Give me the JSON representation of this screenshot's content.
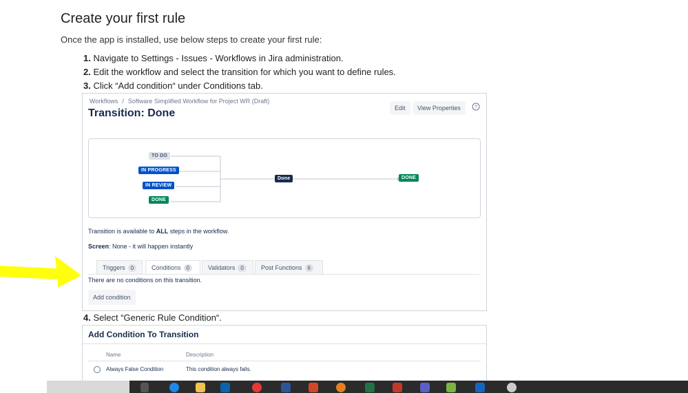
{
  "doc": {
    "title": "Create your first rule",
    "intro": "Once the app is installed, use below steps to create your first rule:",
    "steps": [
      {
        "num": "1.",
        "text": " Navigate to Settings - Issues - Workflows in Jira administration."
      },
      {
        "num": "2.",
        "text": " Edit the workflow and select the transition for which you want to define rules."
      },
      {
        "num": "3.",
        "text": " Click “Add condition“ under Conditions tab."
      },
      {
        "num": "4.",
        "text": " Select “Generic Rule Condition“."
      }
    ]
  },
  "jira": {
    "breadcrumb": {
      "root": "Workflows",
      "sep": "/",
      "current": "Software Simplified Workflow for Project WR (Draft)"
    },
    "title": "Transition: Done",
    "edit_label": "Edit",
    "props_label": "View Properties",
    "statuses": [
      "TO DO",
      "IN PROGRESS",
      "IN REVIEW",
      "DONE"
    ],
    "transition_label": "Done",
    "target_status": "DONE",
    "availability": {
      "prefix": "Transition is available to ",
      "bold": "ALL",
      "suffix": " steps in the workflow."
    },
    "screen": {
      "label": "Screen",
      "value": ": None - it will happen instantly"
    },
    "tabs": [
      {
        "label": "Triggers",
        "count": "0"
      },
      {
        "label": "Conditions",
        "count": "0"
      },
      {
        "label": "Validators",
        "count": "0"
      },
      {
        "label": "Post Functions",
        "count": "6"
      }
    ],
    "no_conditions": "There are no conditions on this transition.",
    "add_condition": "Add condition"
  },
  "dialog": {
    "title": "Add Condition To Transition",
    "col_name": "Name",
    "col_desc": "Description",
    "rows": [
      {
        "name": "Always False Condition",
        "desc": "This condition always fails."
      }
    ]
  },
  "colors": {
    "highlight_arrow": "#ffff00",
    "lozenge_blue": "#0052cc",
    "lozenge_green": "#00875a"
  }
}
